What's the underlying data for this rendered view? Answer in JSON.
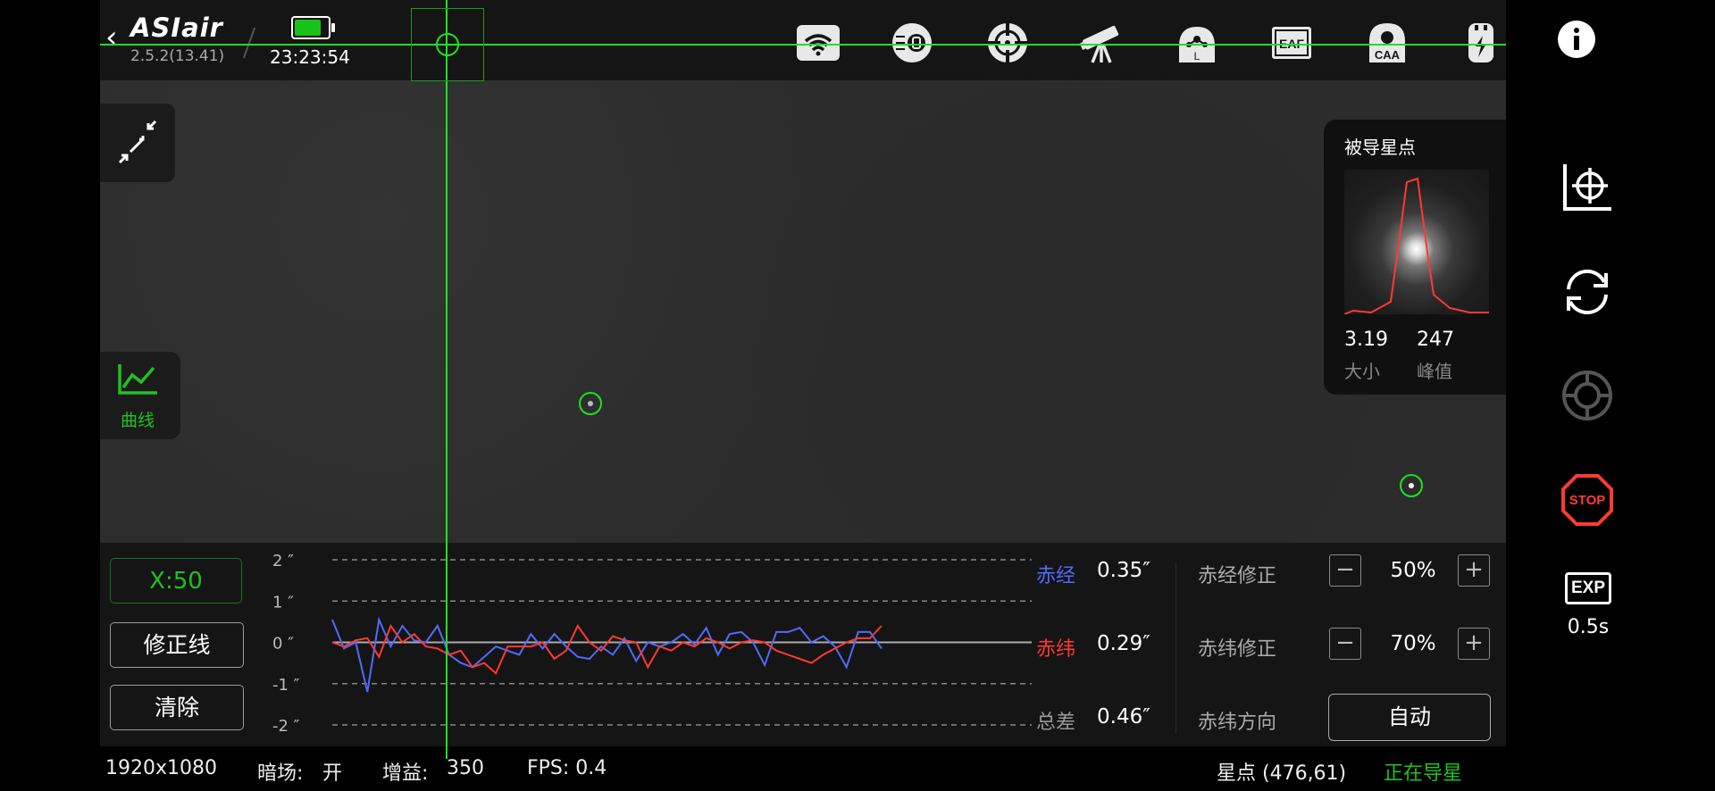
{
  "app": {
    "logo": "ASIair",
    "version": "2.5.2(13.41)",
    "time": "23:23:54",
    "battery_level": 0.8
  },
  "toolbar_icons": [
    "wifi-icon",
    "filter-wheel-icon",
    "guide-target-icon",
    "telescope-icon",
    "focus-lock-icon",
    "eaf-icon",
    "caa-icon",
    "usb-charge-icon"
  ],
  "toolbar_labels": {
    "eaf": "EAF",
    "caa": "CAA",
    "lock": "L"
  },
  "left_controls": {
    "curve_label": "曲线"
  },
  "star_panel": {
    "title": "被导星点",
    "size_value": "3.19",
    "size_label": "大小",
    "peak_value": "247",
    "peak_label": "峰值"
  },
  "guide": {
    "x_scale": "X:50",
    "correction_line_btn": "修正线",
    "clear_btn": "清除",
    "ra_label": "赤经",
    "ra_value": "0.35″",
    "dec_label": "赤纬",
    "dec_value": "0.29″",
    "total_label": "总差",
    "total_value": "0.46″",
    "ra_corr_label": "赤经修正",
    "ra_corr_value": "50%",
    "dec_corr_label": "赤纬修正",
    "dec_corr_value": "70%",
    "dec_dir_label": "赤纬方向",
    "dec_dir_value": "自动",
    "minus": "−",
    "plus": "+"
  },
  "right_panel": {
    "exp_label": "EXP",
    "exp_value": "0.5s",
    "stop_label": "STOP"
  },
  "status": {
    "resolution": "1920x1080",
    "dark_label": "暗场:",
    "dark_value": "开",
    "gain_label": "增益:",
    "gain_value": "350",
    "fps": "FPS: 0.4",
    "star_pos": "星点 (476,61)",
    "state": "正在导星"
  },
  "colors": {
    "accent_green": "#1de21d",
    "ra_blue": "#4f6bff",
    "dec_red": "#ff3a30",
    "stop_red": "#ff3b30"
  },
  "chart_data": {
    "type": "line",
    "y_tick_labels": [
      "2 ″",
      "1 ″",
      "0 ″",
      "-1 ″",
      "-2 ″"
    ],
    "ylim": [
      -2,
      2
    ],
    "grid": true,
    "series": [
      {
        "name": "赤经",
        "color": "#4f6bff",
        "values": [
          0.55,
          -0.15,
          0.0,
          -1.2,
          0.55,
          -0.1,
          0.4,
          0.05,
          0.0,
          0.4,
          -0.3,
          -0.5,
          -0.6,
          -0.35,
          -0.1,
          -0.2,
          -0.3,
          0.2,
          -0.15,
          0.2,
          -0.1,
          -0.35,
          -0.4,
          -0.1,
          -0.3,
          0.1,
          -0.45,
          0.0,
          -0.1,
          0.0,
          0.2,
          -0.05,
          0.35,
          -0.3,
          0.2,
          0.25,
          0.0,
          -0.55,
          0.25,
          0.25,
          0.35,
          0.0,
          0.15,
          -0.1,
          -0.6,
          0.25,
          0.25,
          -0.15
        ]
      },
      {
        "name": "赤纬",
        "color": "#ff3a30",
        "values": [
          0.0,
          -0.1,
          0.05,
          0.1,
          -0.35,
          0.4,
          0.0,
          0.2,
          -0.1,
          -0.15,
          -0.3,
          -0.2,
          -0.6,
          -0.5,
          -0.75,
          -0.1,
          -0.1,
          -0.1,
          0.0,
          -0.4,
          -0.2,
          0.4,
          0.0,
          -0.2,
          0.15,
          0.05,
          0.0,
          -0.6,
          -0.1,
          -0.2,
          0.0,
          -0.1,
          0.1,
          0.0,
          -0.15,
          0.0,
          0.05,
          0.0,
          -0.2,
          -0.3,
          -0.4,
          -0.5,
          -0.3,
          -0.15,
          0.0,
          0.1,
          0.1,
          0.4
        ]
      }
    ]
  }
}
